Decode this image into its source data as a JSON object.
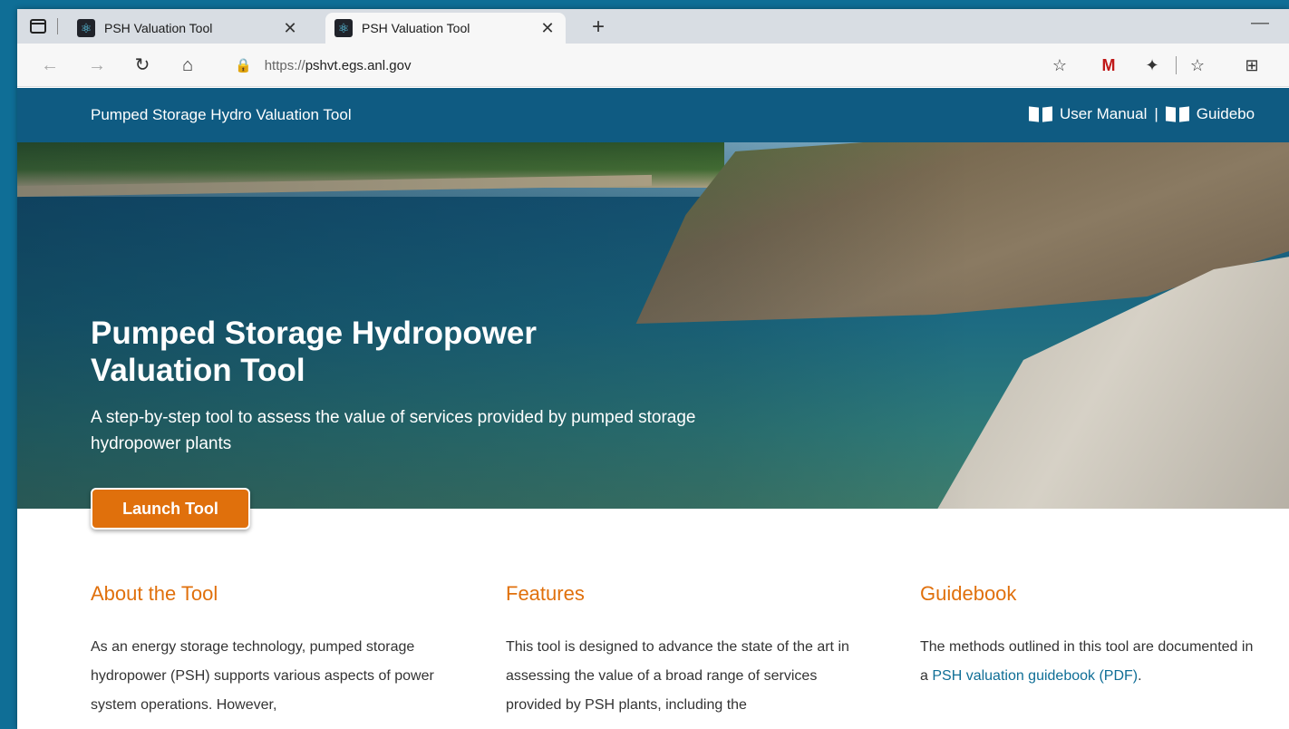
{
  "browser": {
    "tabs": [
      {
        "title": "PSH Valuation Tool",
        "active": false
      },
      {
        "title": "PSH Valuation Tool",
        "active": true
      }
    ],
    "url_protocol": "https://",
    "url_host": "pshvt.egs.anl.gov",
    "icons": {
      "back": "back-arrow-icon",
      "forward": "forward-arrow-icon",
      "refresh": "refresh-icon",
      "home": "home-icon",
      "lock": "lock-icon"
    }
  },
  "header": {
    "title": "Pumped Storage Hydro Valuation Tool",
    "user_manual": "User Manual",
    "separator": "|",
    "guidebook": "Guidebo"
  },
  "hero": {
    "title": "Pumped Storage Hydropower Valuation Tool",
    "subtitle": "A step-by-step tool to assess the value of services provided by pumped storage hydropower plants",
    "launch_label": "Launch Tool"
  },
  "sections": {
    "about": {
      "heading": "About the Tool",
      "text": "As an energy storage technology, pumped storage hydropower (PSH) supports various aspects of power system operations. However,"
    },
    "features": {
      "heading": "Features",
      "text": "This tool is designed to advance the state of the art in assessing the value of a broad range of services provided by PSH plants, including the"
    },
    "guidebook": {
      "heading": "Guidebook",
      "text_before": "The methods outlined in this tool are documented in a ",
      "link": "PSH valuation guidebook (PDF)",
      "text_after": "."
    }
  },
  "colors": {
    "accent": "#e0700c",
    "header_bg": "#0f5b82",
    "link": "#0f6e96"
  }
}
